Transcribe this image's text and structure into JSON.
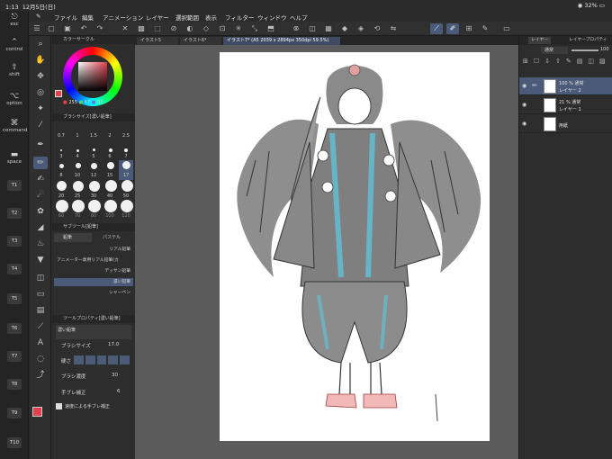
{
  "status_bar": {
    "time": "1:13",
    "date": "12月5日(日)",
    "wifi": "wifi-icon",
    "battery": "32%"
  },
  "edge_keys": [
    {
      "glyph": "⎋",
      "label": "esc"
    },
    {
      "glyph": "⌃",
      "label": "control"
    },
    {
      "glyph": "⇧",
      "label": "shift"
    },
    {
      "glyph": "⌥",
      "label": "option"
    },
    {
      "glyph": "⌘",
      "label": "command"
    },
    {
      "glyph": "▬",
      "label": "space"
    }
  ],
  "t_keys": [
    "T1",
    "T2",
    "T3",
    "T4",
    "T5",
    "T6",
    "T7",
    "T8",
    "T9",
    "T10"
  ],
  "menu": [
    "ファイル",
    "編集",
    "アニメーション",
    "レイヤー",
    "選択範囲",
    "表示",
    "フィルター",
    "ウィンドウ",
    "ヘルプ"
  ],
  "tabs": [
    {
      "label": "イラスト5"
    },
    {
      "label": "イラスト6*"
    },
    {
      "label": "イラスト7* (A5 2039 x 2894px 350dpi 59.5%)"
    }
  ],
  "color_panel": {
    "title": "カラーサークル",
    "values": [
      "255",
      "67",
      "91"
    ],
    "main_color": "#e0414f"
  },
  "brush_size_panel": {
    "title": "ブラシサイズ[濃い鉛筆]",
    "rows": [
      [
        "0.7",
        "1",
        "1.5",
        "2",
        "2.5"
      ],
      [
        "3",
        "4",
        "5",
        "6",
        "7"
      ],
      [
        "8",
        "10",
        "12",
        "15",
        "17"
      ],
      [
        "20",
        "25",
        "30",
        "40",
        "50"
      ],
      [
        "60",
        "70",
        "80",
        "100",
        "120"
      ]
    ]
  },
  "subtool_panel": {
    "title": "サブツール[鉛筆]",
    "tab_pencil": "鉛筆",
    "tab_pastel": "パステル",
    "items": [
      "リアル鉛筆",
      "アニメーター専用リアル鉛筆(カ",
      "デッサン鉛筆",
      "濃い鉛筆",
      "シャーペン"
    ]
  },
  "tool_property": {
    "title": "ツールプロパティ[濃い鉛筆]",
    "name": "濃い鉛筆",
    "brush_size_label": "ブラシサイズ",
    "brush_size_value": "17.0",
    "hardness_label": "硬さ",
    "density_label": "ブラシ濃度",
    "density_value": "30",
    "stabilization_label": "手ブレ補正",
    "stabilization_value": "6",
    "speed_label": "速度による手ブレ補正"
  },
  "layer_panel": {
    "tab_layer": "レイヤー",
    "tab_property": "レイヤープロパティ",
    "blend_mode": "通常",
    "opacity": "100",
    "layers": [
      {
        "line1": "100 % 通常",
        "line2": "レイヤー 2",
        "active": true
      },
      {
        "line1": "21 % 通常",
        "line2": "レイヤー 1",
        "active": false
      },
      {
        "line1": "",
        "line2": "用紙",
        "active": false
      }
    ]
  },
  "colors": {
    "accent": "#4a5a78",
    "panel": "#2d2d2d",
    "canvas_bg": "#5b5b5b",
    "sketch_blue": "#5ec8e0",
    "sketch_pink": "#e07070"
  }
}
